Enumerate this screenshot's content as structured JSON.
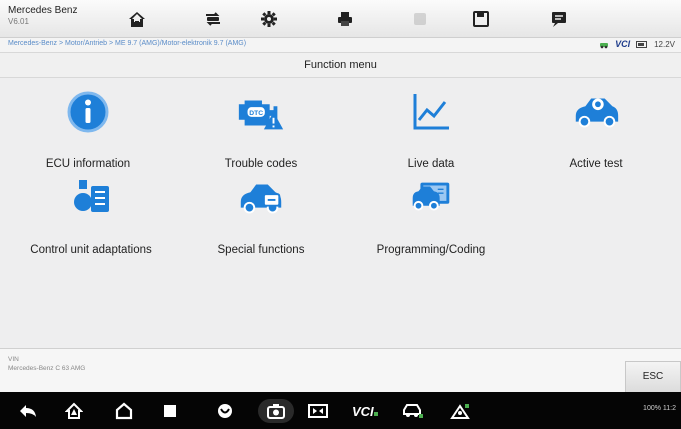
{
  "toolbar": {
    "brand_line1": "Mercedes Benz",
    "brand_line2": "V6.01",
    "buttons": [
      "home-icon",
      "car-swap-icon",
      "settings-icon",
      "print-icon",
      "help-icon",
      "save-icon",
      "datalog-icon"
    ]
  },
  "breadcrumb": {
    "path": "Mercedes-Benz > Motor/Antrieb > ME 9.7 (AMG)/Motor-elektronik 9.7 (AMG)",
    "current": ""
  },
  "status": {
    "vci": "VCI",
    "voltage": "12.2V"
  },
  "function_menu": {
    "title": "Function menu",
    "items": [
      {
        "label": "ECU information",
        "icon": "info-icon"
      },
      {
        "label": "Trouble codes",
        "icon": "dtc-engine-icon"
      },
      {
        "label": "Live data",
        "icon": "live-graph-icon"
      },
      {
        "label": "Active test",
        "icon": "car-gear-icon"
      },
      {
        "label": "Control unit adaptations",
        "icon": "adaptation-icon"
      },
      {
        "label": "Special functions",
        "icon": "car-wrench-icon"
      },
      {
        "label": "Programming/Coding",
        "icon": "programming-icon"
      }
    ]
  },
  "vehicle_info": {
    "line1": "VIN",
    "line2": "Mercedes-Benz C 63 AMG"
  },
  "esc_label": "ESC",
  "navbar": {
    "items": [
      "back-icon",
      "maxifix-home-icon",
      "android-home-icon",
      "recent-apps-icon",
      "browser-icon",
      "camera-icon",
      "display-icon",
      "vci-icon",
      "vehicle-icon",
      "remote-icon"
    ],
    "status": "100% 11:2"
  },
  "colors": {
    "accent": "#1e7fd8",
    "warning": "#f0a800"
  }
}
